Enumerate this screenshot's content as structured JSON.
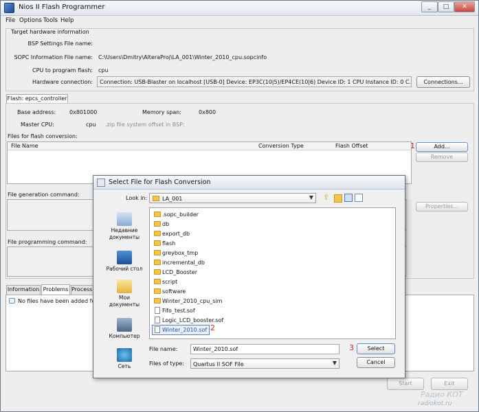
{
  "window": {
    "title": "Nios II Flash Programmer",
    "controls": [
      "minimize",
      "maximize",
      "close"
    ]
  },
  "menu": [
    "File",
    "Options",
    "Tools",
    "Help"
  ],
  "target": {
    "section": "Target hardware information",
    "bsp_label": "BSP Settings File name:",
    "sopc_label": "SOPC Information File name:",
    "sopc_value": "C:\\Users\\Dmitry\\AlteraProj\\LA_001\\Winter_2010_cpu.sopcinfo",
    "cpu_label": "CPU to program flash:",
    "cpu_value": "cpu",
    "hw_label": "Hardware connection:",
    "hw_value": "Connection: USB-Blaster on localhost [USB-0]     Device: EP3C(10|5)/EP4CE(10|6)     Device ID: 1    CPU Instance ID: 0     C...",
    "connections_button": "Connections..."
  },
  "flash_tab": "Flash: epcs_controller",
  "flash": {
    "base_label": "Base address:",
    "base_value": "0x801000",
    "memspan_label": "Memory span:",
    "memspan_value": "0x800",
    "master_label": "Master CPU:",
    "master_value": "cpu",
    "zip_label": ".zip file system offset in BSP:",
    "files_label": "Files for flash conversion:",
    "col_filename": "File Name",
    "col_conversion": "Conversion Type",
    "col_offset": "Flash Offset",
    "add_button": "Add...",
    "remove_button": "Remove",
    "properties_button": "Properties...",
    "filegen_label": "File generation command:",
    "fileprog_label": "File programming command:"
  },
  "bottom_tabs": [
    "Information",
    "Problems",
    "Processing"
  ],
  "problems_text": "No files have been added for",
  "start_button": "Start",
  "exit_button": "Exit",
  "annotations": {
    "n1": "1",
    "n2": "2",
    "n3": "3"
  },
  "dialog": {
    "title": "Select File for Flash Conversion",
    "lookin_label": "Look in:",
    "lookin_value": "LA_001",
    "places": [
      "Недавние документы",
      "Рабочий стол",
      "Мои документы",
      "Компьютер",
      "Сеть"
    ],
    "files": [
      {
        "name": ".sopc_builder",
        "type": "folder"
      },
      {
        "name": "db",
        "type": "folder"
      },
      {
        "name": "export_db",
        "type": "folder"
      },
      {
        "name": "flash",
        "type": "folder"
      },
      {
        "name": "greybox_tmp",
        "type": "folder"
      },
      {
        "name": "incremental_db",
        "type": "folder"
      },
      {
        "name": "LCD_Booster",
        "type": "folder"
      },
      {
        "name": "script",
        "type": "folder"
      },
      {
        "name": "software",
        "type": "folder"
      },
      {
        "name": "Winter_2010_cpu_sim",
        "type": "folder"
      },
      {
        "name": "Fifo_test.sof",
        "type": "file"
      },
      {
        "name": "Logic_LCD_booster.sof",
        "type": "file"
      },
      {
        "name": "Winter_2010.sof",
        "type": "file",
        "selected": true
      }
    ],
    "filename_label": "File name:",
    "filename_value": "Winter_2010.sof",
    "filetype_label": "Files of type:",
    "filetype_value": "Quartus II SOF File",
    "select_button": "Select",
    "cancel_button": "Cancel"
  },
  "watermark": {
    "logo": "Радио КОТ",
    "url": "radiokot.ru"
  }
}
